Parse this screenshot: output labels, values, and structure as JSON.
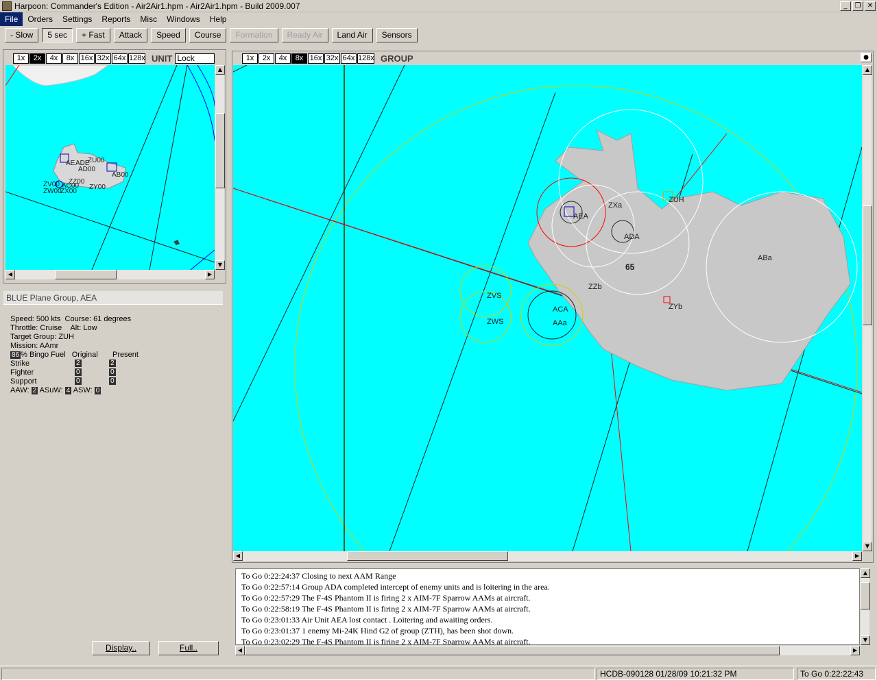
{
  "window": {
    "title": "Harpoon: Commander's Edition - Air2Air1.hpm - Air2Air1.hpm - Build 2009.007"
  },
  "menu": [
    "File",
    "Orders",
    "Settings",
    "Reports",
    "Misc",
    "Windows",
    "Help"
  ],
  "toolbar": [
    "- Slow",
    "5 sec",
    "+ Fast",
    "Attack",
    "Speed",
    "Course",
    "Formation",
    "Ready Air",
    "Land Air",
    "Sensors"
  ],
  "unit_map": {
    "zoom_levels": [
      "1x",
      "2x",
      "4x",
      "8x",
      "16x",
      "32x",
      "64x",
      "128x"
    ],
    "selected_zoom": "2x",
    "mode_label": "UNIT",
    "lock_label": "Lock",
    "labels": [
      "AE",
      "ADE",
      "ZU00",
      "AD00",
      "AB00",
      "ZZ00",
      "ZY00",
      "ZV00",
      "ZW00",
      "ZX00",
      "AC00"
    ]
  },
  "group_map": {
    "zoom_levels": [
      "1x",
      "2x",
      "4x",
      "8x",
      "16x",
      "32x",
      "64x",
      "128x"
    ],
    "selected_zoom": "8x",
    "mode_label": "GROUP",
    "labels": [
      "AEA",
      "ZXa",
      "ZUH",
      "ADA",
      "ABa",
      "65",
      "ZZb",
      "ZVS",
      "ACA",
      "AAa",
      "ZWS",
      "ZYb"
    ]
  },
  "unit_info": {
    "header": "BLUE Plane Group, AEA",
    "speed": "Speed: 500 kts",
    "course": "Course: 61 degrees",
    "throttle": "Throttle: Cruise",
    "alt": "Alt: Low",
    "target": "Target Group: ZUH",
    "mission": "Mission: AAmr",
    "bingo_value": "86",
    "bingo_label": "% Bingo Fuel",
    "col_original": "Original",
    "col_present": "Present",
    "rows": [
      {
        "name": "Strike",
        "original": "2",
        "present": "2"
      },
      {
        "name": "Fighter",
        "original": "0",
        "present": "0"
      },
      {
        "name": "Support",
        "original": "0",
        "present": "0"
      }
    ],
    "aaw_label": "AAW:",
    "aaw": "2",
    "asuw_label": "ASuW:",
    "asuw": "4",
    "asw_label": "ASW:",
    "asw": "0",
    "display_button": "Display..",
    "full_button": "Full.."
  },
  "log": [
    "To Go 0:22:24:37  Closing to next AAM Range",
    "To Go 0:22:57:14  Group ADA completed intercept of enemy units and is loitering in the area.",
    "To Go 0:22:57:29  The F-4S Phantom II is firing 2 x AIM-7F Sparrow AAMs at aircraft.",
    "To Go 0:22:58:19  The F-4S Phantom II is firing 2 x AIM-7F Sparrow AAMs at aircraft.",
    "To Go 0:23:01:33  Air Unit AEA lost contact . Loitering and awaiting orders.",
    "To Go 0:23:01:37  1 enemy Mi-24K Hind G2 of group (ZTH), has been shot down.",
    "To Go 0:23:02:29  The F-4S Phantom II is firing 2 x AIM-7F Sparrow AAMs at aircraft."
  ],
  "status": {
    "db": "HCDB-090128 01/28/09 10:21:32 PM",
    "togo": "To Go 0:22:22:43"
  },
  "colors": {
    "sea": "#00ffff",
    "selection": "#0a246a"
  }
}
